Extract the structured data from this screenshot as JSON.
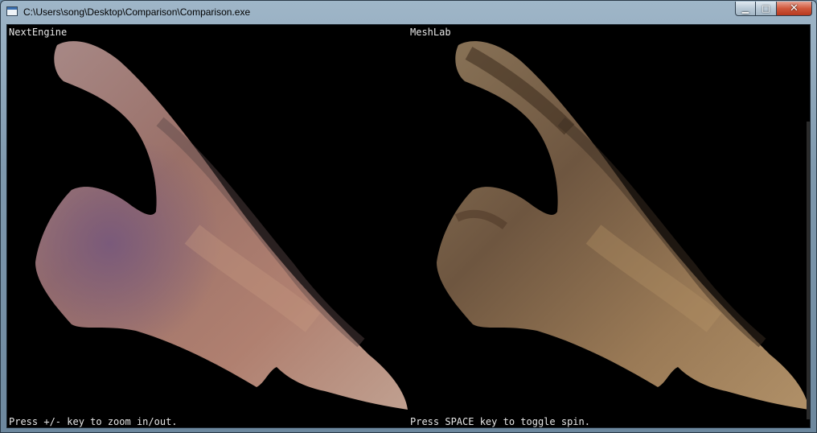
{
  "window": {
    "title": "C:\\Users\\song\\Desktop\\Comparison\\Comparison.exe",
    "controls": {
      "minimize": "▁",
      "maximize": "□",
      "close": "✕"
    }
  },
  "viewports": {
    "left": {
      "label": "NextEngine",
      "hint": "Press +/- key to zoom in/out."
    },
    "right": {
      "label": "MeshLab",
      "hint": "Press SPACE key to toggle spin."
    }
  },
  "colors": {
    "background": "#000000",
    "overlay_text": "#e6e6e6",
    "nextengine_tint": "#9a7068",
    "meshlab_tint": "#8a6a4c"
  }
}
